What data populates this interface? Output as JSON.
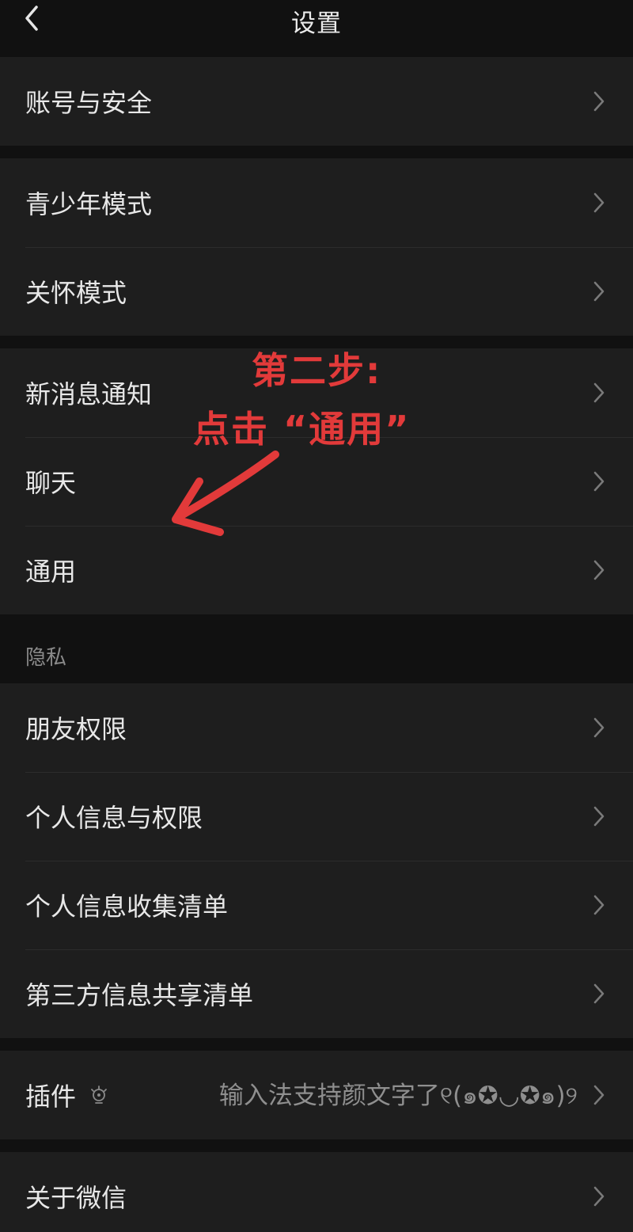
{
  "header": {
    "title": "设置"
  },
  "groups": {
    "account": [
      {
        "label": "账号与安全"
      }
    ],
    "modes": [
      {
        "label": "青少年模式"
      },
      {
        "label": "关怀模式"
      }
    ],
    "general": [
      {
        "label": "新消息通知"
      },
      {
        "label": "聊天"
      },
      {
        "label": "通用"
      }
    ],
    "privacy_title": "隐私",
    "privacy": [
      {
        "label": "朋友权限"
      },
      {
        "label": "个人信息与权限"
      },
      {
        "label": "个人信息收集清单"
      },
      {
        "label": "第三方信息共享清单"
      }
    ],
    "plugin": {
      "label": "插件",
      "tip": "输入法支持颜文字了୧(๑✪◡✪๑)୨"
    },
    "about": [
      {
        "label": "关于微信"
      }
    ]
  },
  "annotation": {
    "line1": "第二步:",
    "line2": "点击 “通用”",
    "color": "#e23a3a"
  },
  "icons": {
    "back": "chevron-left-icon",
    "row_arrow": "chevron-right-icon",
    "plugin": "bulb-icon"
  }
}
